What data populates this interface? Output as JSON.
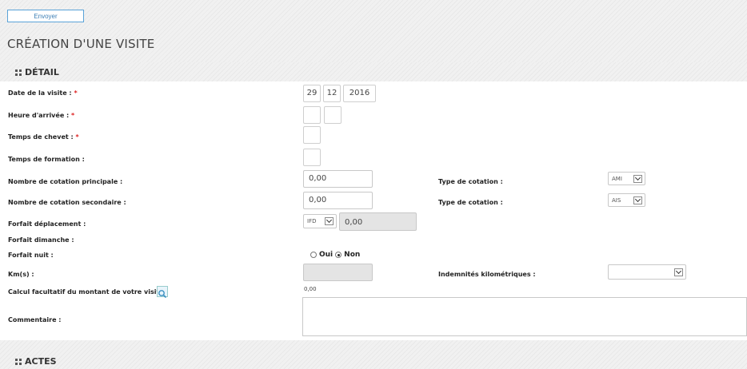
{
  "toolbar": {
    "send_label": "Envoyer"
  },
  "page": {
    "title": "CRÉATION D'UNE VISITE"
  },
  "sections": {
    "detail": "DÉTAIL",
    "actes": "ACTES"
  },
  "fields": {
    "date_label": "Date de la visite :",
    "date_day": "29",
    "date_month": "12",
    "date_year": "2016",
    "arrival_label": "Heure d'arrivée :",
    "bedside_label": "Temps de chevet :",
    "training_label": "Temps de formation :",
    "main_count_label": "Nombre de cotation principale :",
    "main_count_value": "0,00",
    "secondary_count_label": "Nombre de cotation secondaire :",
    "secondary_count_value": "0,00",
    "type1_label": "Type de cotation :",
    "type1_value": "AMI",
    "type2_label": "Type de cotation :",
    "type2_value": "AIS",
    "travel_label": "Forfait déplacement :",
    "travel_select": "IFD",
    "travel_value": "0,00",
    "sunday_label": "Forfait dimanche :",
    "night_label": "Forfait nuit :",
    "night_yes": "Oui",
    "night_no": "Non",
    "night_selected": "Non",
    "km_label": "Km(s) :",
    "km_allowance_label": "Indemnités kilométriques :",
    "calc_label": "Calcul facultatif du montant de votre visite :",
    "calc_value": "0,00",
    "comment_label": "Commentaire :",
    "required_mark": "*"
  },
  "colors": {
    "accent": "#5aa3d8",
    "required": "#dd2222",
    "disabled_bg": "#e4e4e4"
  }
}
